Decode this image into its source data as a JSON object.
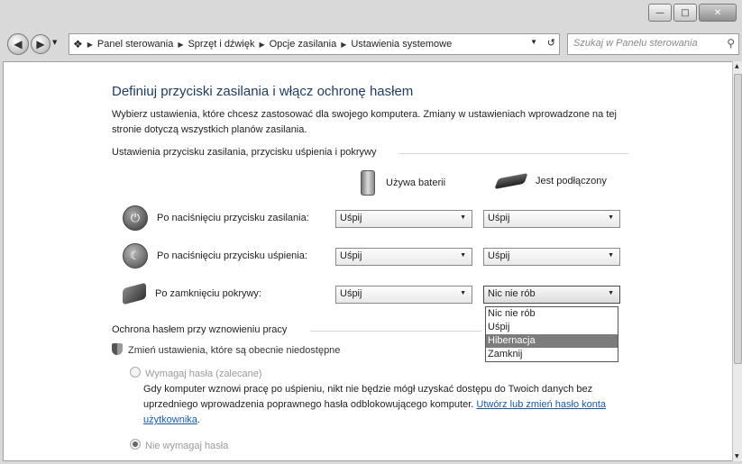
{
  "address": {
    "crumbs": [
      "Panel sterowania",
      "Sprzęt i dźwięk",
      "Opcje zasilania",
      "Ustawienia systemowe"
    ]
  },
  "search": {
    "placeholder": "Szukaj w Panelu sterowania"
  },
  "page": {
    "title": "Definiuj przyciski zasilania i włącz ochronę hasłem",
    "description": "Wybierz ustawienia, które chcesz zastosować dla swojego komputera. Zmiany w ustawieniach wprowadzone na tej stronie dotyczą wszystkich planów zasilania."
  },
  "power_group": {
    "label": "Ustawienia przycisku zasilania, przycisku uśpienia i pokrywy",
    "col_battery": "Używa baterii",
    "col_plugged": "Jest podłączony",
    "rows": [
      {
        "label": "Po naciśnięciu przycisku zasilania:",
        "battery": "Uśpij",
        "plugged": "Uśpij"
      },
      {
        "label": "Po naciśnięciu przycisku uśpienia:",
        "battery": "Uśpij",
        "plugged": "Uśpij"
      },
      {
        "label": "Po zamknięciu pokrywy:",
        "battery": "Uśpij",
        "plugged": "Nic nie rób"
      }
    ],
    "dropdown_options": [
      "Nic nie rób",
      "Uśpij",
      "Hibernacja",
      "Zamknij"
    ],
    "dropdown_highlighted": "Hibernacja"
  },
  "password_group": {
    "label": "Ochrona hasłem przy wznowieniu pracy",
    "change_settings_link": "Zmień ustawienia, które są obecnie niedostępne",
    "require_label": "Wymagaj hasła (zalecane)",
    "require_desc": "Gdy komputer wznowi pracę po uśpieniu, nikt nie będzie mógł uzyskać dostępu do Twoich danych bez uprzedniego wprowadzenia poprawnego hasła odblokowującego komputer.",
    "require_link": "Utwórz lub zmień hasło konta użytkownika",
    "no_require_label": "Nie wymagaj hasła"
  }
}
